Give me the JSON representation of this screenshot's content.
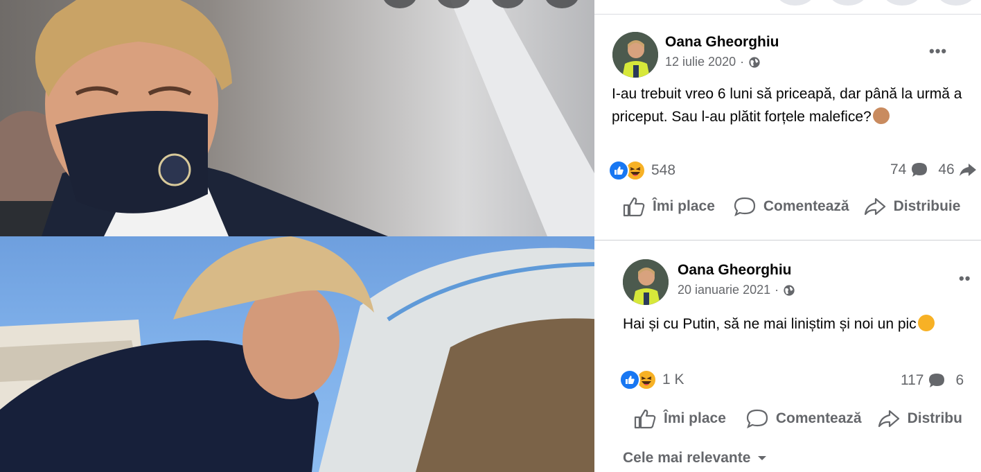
{
  "posts": [
    {
      "author": "Oana Gheorghiu",
      "date": "12 iulie 2020",
      "separator": "·",
      "text": "I-au trebuit vreo 6 luni să priceapă, dar până la urmă a priceput. Sau l-au plătit forțele malefice?",
      "text_emoji": "monkey-face",
      "reaction_count": "548",
      "comment_count": "74",
      "share_count": "46",
      "actions": {
        "like": "Îmi place",
        "comment": "Comentează",
        "share": "Distribuie"
      }
    },
    {
      "author": "Oana Gheorghiu",
      "date": "20 ianuarie 2021",
      "separator": "·",
      "text": "Hai și cu Putin, să ne mai liniștim și noi un pic",
      "text_emoji": "smiling-face",
      "reaction_count": "1 K",
      "comment_count": "117",
      "share_count": "6",
      "actions": {
        "like": "Îmi place",
        "comment": "Comentează",
        "share": "Distribu"
      }
    }
  ],
  "sort_label": "Cele mai relevante",
  "colors": {
    "text": "#050505",
    "secondary": "#65676b",
    "like_blue": "#1877f2",
    "haha_yellow": "#f7b125",
    "divider": "#ced0d4"
  }
}
